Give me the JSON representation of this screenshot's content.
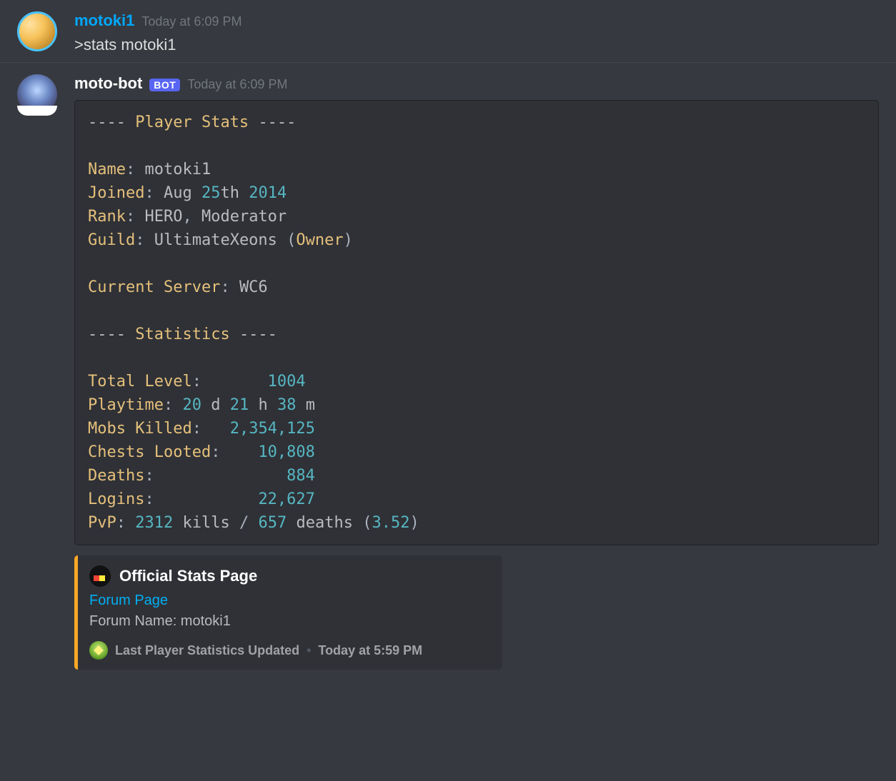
{
  "messages": {
    "user": {
      "username": "motoki1",
      "timestamp": "Today at 6:09 PM",
      "content": ">stats motoki1"
    },
    "bot": {
      "username": "moto-bot",
      "bot_tag": "BOT",
      "timestamp": "Today at 6:09 PM"
    }
  },
  "stats": {
    "header1": "Player Stats",
    "name_label": "Name",
    "name_value": "motoki1",
    "joined_label": "Joined",
    "joined_month": "Aug",
    "joined_day": "25",
    "joined_day_suffix": "th",
    "joined_year": "2014",
    "rank_label": "Rank",
    "rank_value1": "HERO",
    "rank_value2": "Moderator",
    "guild_label": "Guild",
    "guild_value": "UltimateXeons",
    "guild_role": "Owner",
    "server_label": "Current Server",
    "server_value": "WC6",
    "header2": "Statistics",
    "total_level_label": "Total Level",
    "total_level_value": "1004",
    "playtime_label": "Playtime",
    "playtime_d": "20",
    "playtime_h": "21",
    "playtime_m": "38",
    "mobs_label": "Mobs Killed",
    "mobs_value": "2,354,125",
    "chests_label": "Chests Looted",
    "chests_value": "10,808",
    "deaths_label": "Deaths",
    "deaths_value": "884",
    "logins_label": "Logins",
    "logins_value": "22,627",
    "pvp_label": "PvP",
    "pvp_kills": "2312",
    "pvp_kills_word": "kills",
    "pvp_deaths": "657",
    "pvp_deaths_word": "deaths",
    "pvp_ratio": "3.52"
  },
  "embed": {
    "title": "Official Stats Page",
    "link": "Forum Page",
    "desc": "Forum Name: motoki1",
    "footer_label": "Last Player Statistics Updated",
    "footer_time": "Today at 5:59 PM"
  }
}
